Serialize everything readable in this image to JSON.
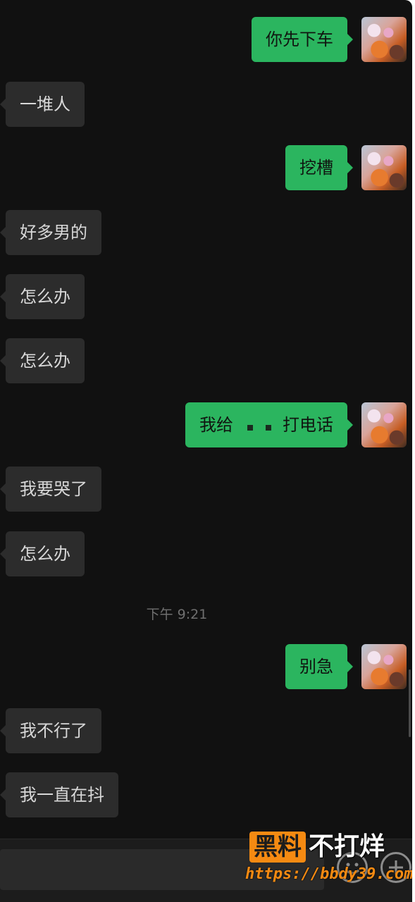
{
  "messages": [
    {
      "side": "out",
      "text": "你先下车"
    },
    {
      "side": "in",
      "text": "一堆人"
    },
    {
      "side": "out",
      "text": "挖槽"
    },
    {
      "side": "in",
      "text": "好多男的"
    },
    {
      "side": "in",
      "text": "怎么办"
    },
    {
      "side": "in",
      "text": "怎么办"
    },
    {
      "side": "out",
      "text_before": "我给",
      "text_after": "打电话"
    },
    {
      "side": "in",
      "text": "我要哭了"
    },
    {
      "side": "in",
      "text": "怎么办"
    },
    {
      "side": "out",
      "text": "别急"
    },
    {
      "side": "in",
      "text": "我不行了"
    },
    {
      "side": "in",
      "text": "我一直在抖"
    }
  ],
  "timestamp": "下午 9:21",
  "input_bar": {
    "emoji_icon": "emoji-icon",
    "plus_icon": "plus-icon"
  },
  "watermark": {
    "badge": "黑料",
    "text": "不打烊",
    "url": "https://bbdy39.com"
  },
  "colors": {
    "background": "#111111",
    "outgoing_bubble": "#2bb55f",
    "incoming_bubble": "#2c2c2c",
    "watermark_accent": "#f58a12"
  }
}
